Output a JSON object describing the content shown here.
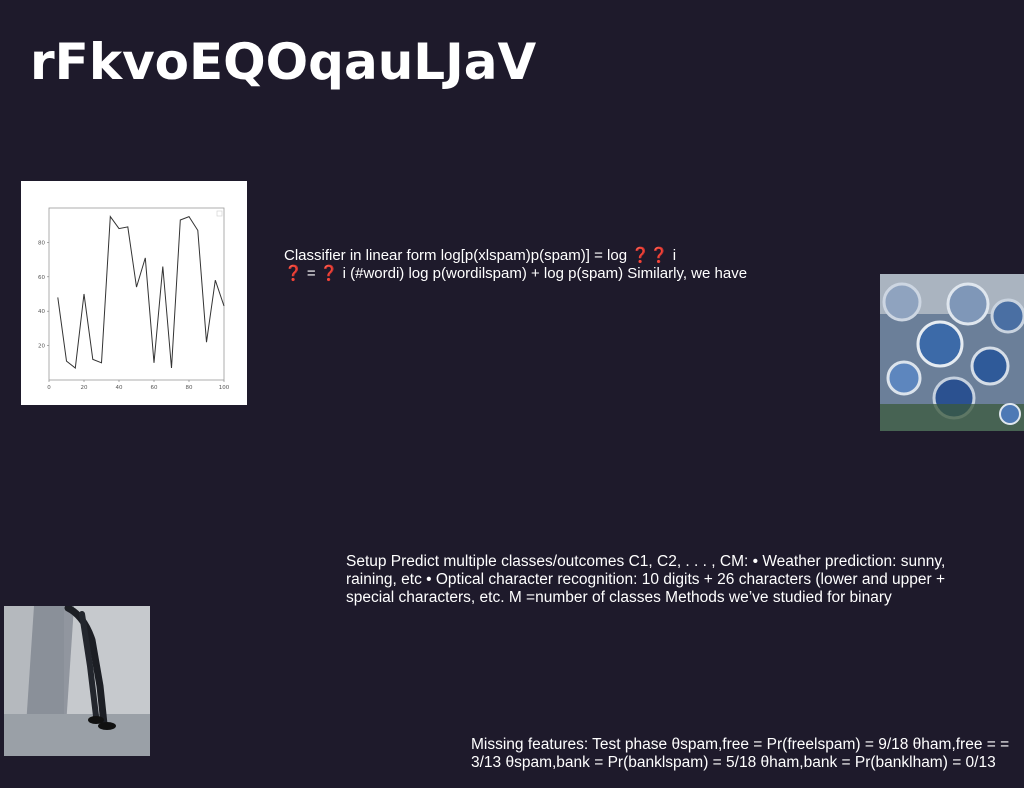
{
  "slide": {
    "title": "rFkvoEQOqauLJaV",
    "paragraph1_line1": "Classifier in linear form log[p(xlspam)p(spam)] = log ❓❓ i",
    "paragraph1_line2": "❓ = ❓ i (#wordi) log p(wordilspam) + log p(spam) Similarly, we have",
    "paragraph2": "Setup Predict multiple classes/outcomes C1, C2, . . . , CM: • Weather prediction: sunny, raining, etc • Optical character recognition: 10 digits + 26 characters (lower and upper + special characters, etc. M =number of classes Methods we’ve studied for binary",
    "paragraph3": "Missing features: Test phase θspam,free = Pr(freelspam) = 9/18 θham,free = = 3/13 θspam,bank = Pr(banklspam) = 5/18 θham,bank = Pr(banklham) = 0/13"
  },
  "colors": {
    "background": "#1e1a2b",
    "text": "#ffffff",
    "line": "#333333"
  },
  "images": {
    "top_right": "photo-blue-circular-objects",
    "bottom_left": "photo-person-bending-over"
  },
  "chart_data": {
    "type": "line",
    "x": [
      5,
      10,
      15,
      20,
      25,
      30,
      35,
      40,
      45,
      50,
      55,
      60,
      65,
      70,
      75,
      80,
      85,
      90,
      95,
      100
    ],
    "values": [
      48,
      11,
      7,
      50,
      12,
      10,
      95,
      88,
      89,
      54,
      71,
      10,
      66,
      7,
      93,
      95,
      87,
      22,
      58,
      43
    ],
    "xlim": [
      0,
      100
    ],
    "ylim": [
      0,
      100
    ],
    "xticks": [
      "0",
      "20",
      "40",
      "60",
      "80",
      "100"
    ],
    "yticks": [
      "20",
      "40",
      "60",
      "80"
    ],
    "xtick_values": [
      0,
      20,
      40,
      60,
      80,
      100
    ],
    "ytick_values": [
      20,
      40,
      60,
      80
    ]
  }
}
